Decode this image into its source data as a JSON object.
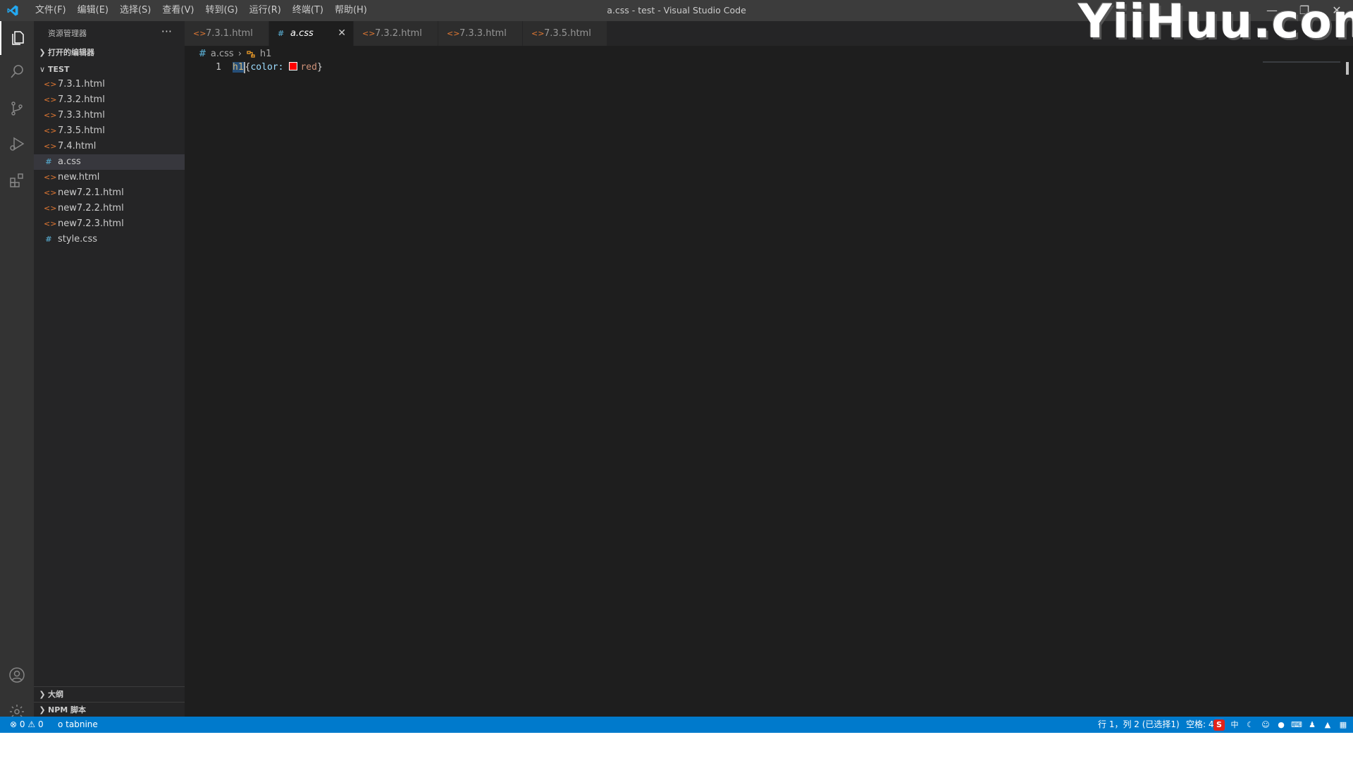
{
  "window": {
    "title": "a.css - test - Visual Studio Code",
    "minimize": "—",
    "restore": "❐",
    "close": "✕"
  },
  "watermark": "YiiHuu.com",
  "menu": [
    "文件(F)",
    "编辑(E)",
    "选择(S)",
    "查看(V)",
    "转到(G)",
    "运行(R)",
    "终端(T)",
    "帮助(H)"
  ],
  "sidebar": {
    "title": "资源管理器",
    "more": "···",
    "open_editors": "打开的编辑器",
    "folder": "TEST",
    "files": [
      {
        "name": "7.3.1.html",
        "type": "html"
      },
      {
        "name": "7.3.2.html",
        "type": "html"
      },
      {
        "name": "7.3.3.html",
        "type": "html"
      },
      {
        "name": "7.3.5.html",
        "type": "html"
      },
      {
        "name": "7.4.html",
        "type": "html"
      },
      {
        "name": "a.css",
        "type": "css",
        "selected": true
      },
      {
        "name": "new.html",
        "type": "html"
      },
      {
        "name": "new7.2.1.html",
        "type": "html"
      },
      {
        "name": "new7.2.2.html",
        "type": "html"
      },
      {
        "name": "new7.2.3.html",
        "type": "html"
      },
      {
        "name": "style.css",
        "type": "css"
      }
    ],
    "outline": "大纲",
    "npm": "NPM 脚本"
  },
  "tabs": [
    {
      "label": "7.3.1.html",
      "type": "html"
    },
    {
      "label": "a.css",
      "type": "css",
      "active": true
    },
    {
      "label": "7.3.2.html",
      "type": "html"
    },
    {
      "label": "7.3.3.html",
      "type": "html"
    },
    {
      "label": "7.3.5.html",
      "type": "html"
    }
  ],
  "breadcrumb": {
    "file": "a.css",
    "symbol": "h1"
  },
  "editor": {
    "line_number": "1",
    "selector": "h1",
    "open_brace": "{",
    "property": "color:",
    "value": "red",
    "close_brace": "}",
    "swatch_color": "#ff0000"
  },
  "statusbar": {
    "errors": "0",
    "warnings": "0",
    "tabnine": "o tabnine",
    "position": "行 1，列 2 (已选择1)",
    "spaces": "空格: 4"
  },
  "colors": {
    "statusbar": "#007acc",
    "editor_bg": "#1e1e1e",
    "sidebar_bg": "#252526",
    "activity_bg": "#333333",
    "titlebar_bg": "#3c3c3c"
  }
}
